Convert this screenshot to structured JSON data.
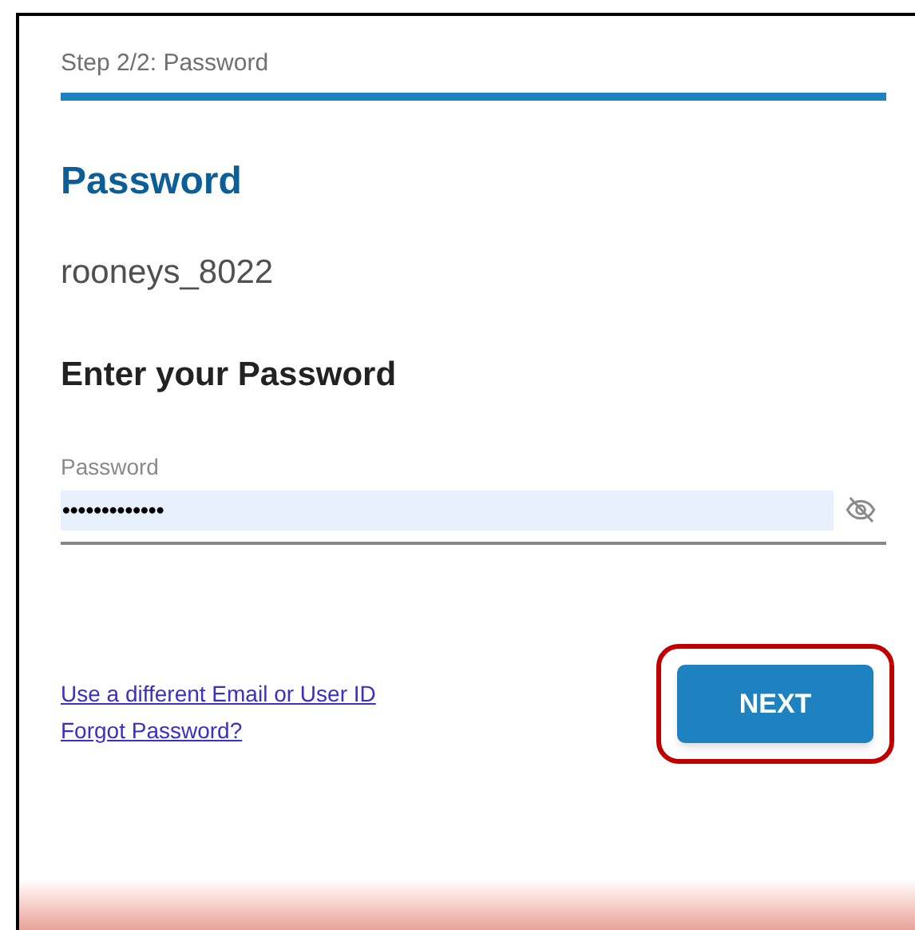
{
  "step": {
    "label": "Step 2/2: Password",
    "level": 1
  },
  "heading": "Password",
  "username": "rooneys_8022",
  "prompt": "Enter your Password",
  "password_field": {
    "label": "Password",
    "value": "•••••••••••••",
    "masked": true
  },
  "links": [
    "Use a different Email or User ID",
    "Forgot Password?"
  ],
  "next_button": {
    "label": "NEXT",
    "highlighted": true
  }
}
